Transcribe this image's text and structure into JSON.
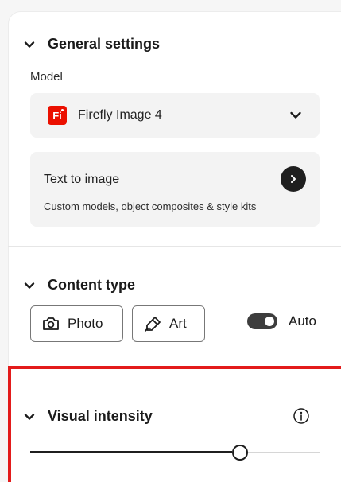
{
  "general": {
    "title": "General settings",
    "model_label": "Model",
    "model_logo": "Fi",
    "model_value": "Firefly Image 4",
    "t2i": {
      "title": "Text to image",
      "subtitle": "Custom models, object composites & style kits"
    }
  },
  "content_type": {
    "title": "Content type",
    "photo_label": "Photo",
    "art_label": "Art",
    "auto_label": "Auto",
    "auto_on": true
  },
  "visual_intensity": {
    "title": "Visual intensity",
    "value_fraction": 0.725
  },
  "colors": {
    "accent_red": "#e31b1b",
    "firefly_red": "#eb1000",
    "dark": "#1f1f1f"
  },
  "icons": {
    "section_chevron": "chevron-down-icon",
    "select_chevron": "chevron-down-icon",
    "go": "arrow-right-circle-icon",
    "photo": "camera-icon",
    "art": "brush-icon",
    "info": "info-icon"
  }
}
